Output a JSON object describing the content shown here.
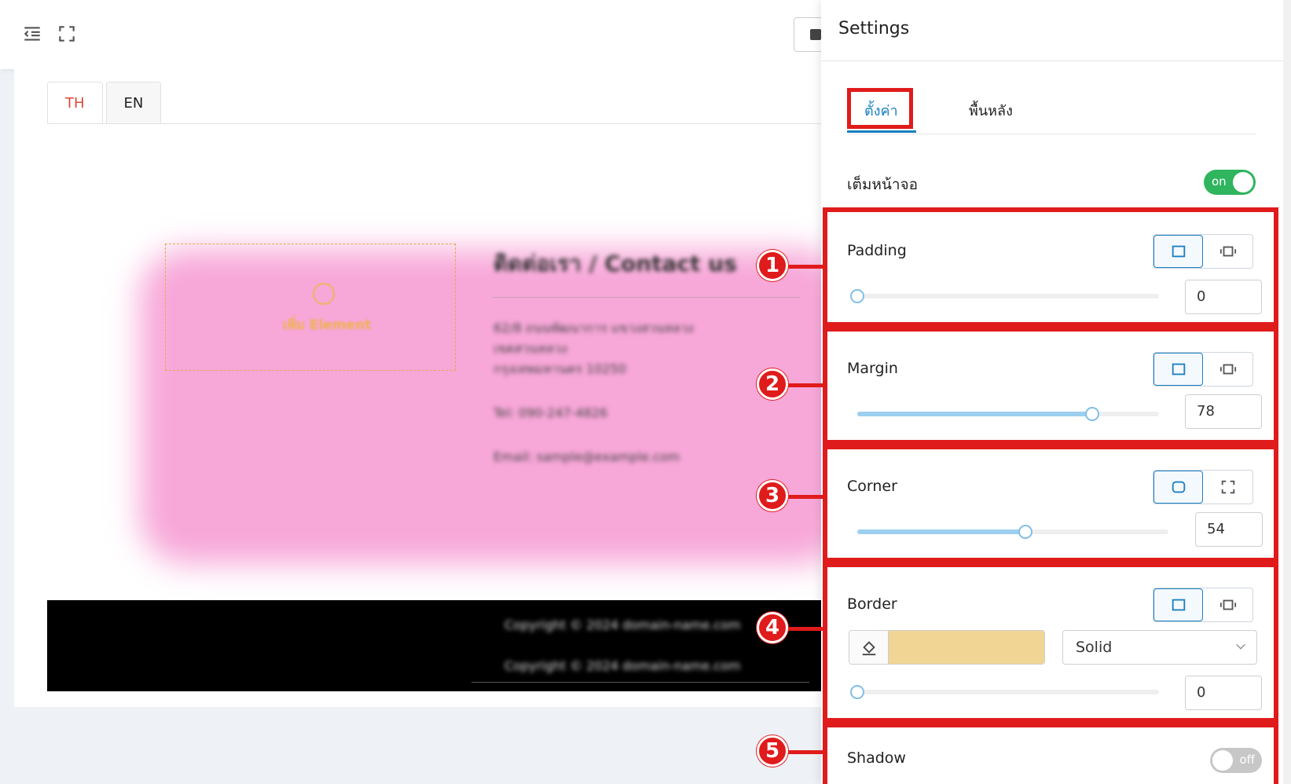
{
  "toolbar": {
    "menu_icon": "menu-collapse-icon",
    "fullscreen_icon": "fullscreen-icon"
  },
  "editor": {
    "lang_tabs": [
      {
        "label": "TH",
        "active": true
      },
      {
        "label": "EN",
        "active": false
      }
    ],
    "dropzone_label": "เพิ่ม Element",
    "contact_title": "ติดต่อเรา / Contact us",
    "contact_lines": [
      "62/8 ถนนพัฒนาการ แขวงสวนหลวง",
      "เขตสวนหลวง",
      "กรุงเทพมหานคร 10250",
      "Tel: 090-247-4826",
      "Email: sample@example.com"
    ],
    "footer_lines": [
      "Copyright © 2024 domain-name.com",
      "Copyright © 2024 domain-name.com"
    ],
    "background_color": "#f7a7d8"
  },
  "markers": [
    "1",
    "2",
    "3",
    "4",
    "5"
  ],
  "settings": {
    "title": "Settings",
    "tabs": [
      {
        "label": "ตั้งค่า",
        "active": true
      },
      {
        "label": "พื้นหลัง",
        "active": false
      }
    ],
    "fullscreen": {
      "label": "เต็มหน้าจอ",
      "state": "on"
    },
    "padding": {
      "label": "Padding",
      "value": "0",
      "fraction": 0.0
    },
    "margin": {
      "label": "Margin",
      "value": "78",
      "fraction": 0.78
    },
    "corner": {
      "label": "Corner",
      "value": "54",
      "fraction": 0.54
    },
    "border": {
      "label": "Border",
      "color": "#f0d594",
      "style": "Solid",
      "value": "0",
      "fraction": 0.0
    },
    "shadow": {
      "label": "Shadow",
      "state": "off"
    },
    "accent_color": "#1a7fc1",
    "highlight_color": "#e01b1b"
  }
}
